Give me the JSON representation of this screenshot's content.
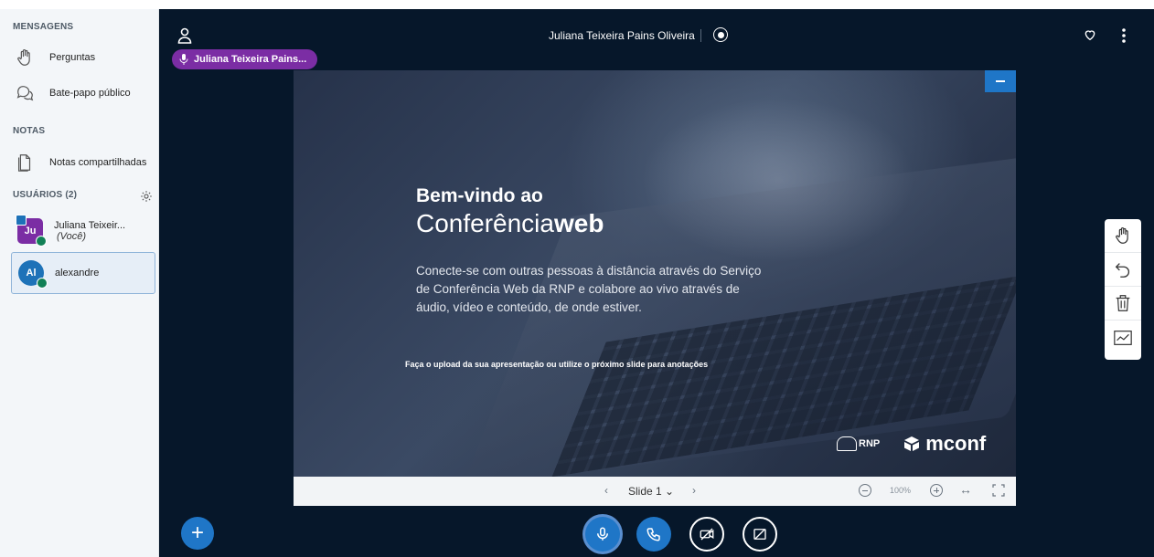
{
  "sidebar": {
    "messages_title": "MENSAGENS",
    "questions_label": "Perguntas",
    "public_chat_label": "Bate-papo público",
    "notes_title": "NOTAS",
    "shared_notes_label": "Notas compartilhadas",
    "users_title": "USUÁRIOS (2)",
    "users": [
      {
        "initials": "Ju",
        "name": "Juliana Teixeir...",
        "you": "(Você)"
      },
      {
        "initials": "Al",
        "name": "alexandre"
      }
    ]
  },
  "header": {
    "title": "Juliana Teixeira Pains Oliveira",
    "talking": "Juliana Teixeira Pains..."
  },
  "slide": {
    "welcome": "Bem-vindo ao",
    "brand_light": "Conferência",
    "brand_bold": "web",
    "description": "Conecte-se com outras pessoas à distância através do Serviço de Conferência Web da RNP e colabore ao vivo através de áudio, vídeo e conteúdo, de onde estiver.",
    "upload_hint": "Faça o upload da sua apresentação ou utilize o próximo slide para anotações",
    "logo_rnp": "RNP",
    "logo_mconf": "mconf"
  },
  "slide_toolbar": {
    "prev": "‹",
    "current_slide": "Slide 1 ⌄",
    "next": "›",
    "zoom": "100%",
    "fit_width": "↔"
  },
  "controls": {
    "add": "+"
  },
  "colors": {
    "accent": "#1f76c7",
    "presenter": "#7b2da4",
    "main_bg": "#06172a",
    "sidebar_bg": "#f3f6f9"
  }
}
